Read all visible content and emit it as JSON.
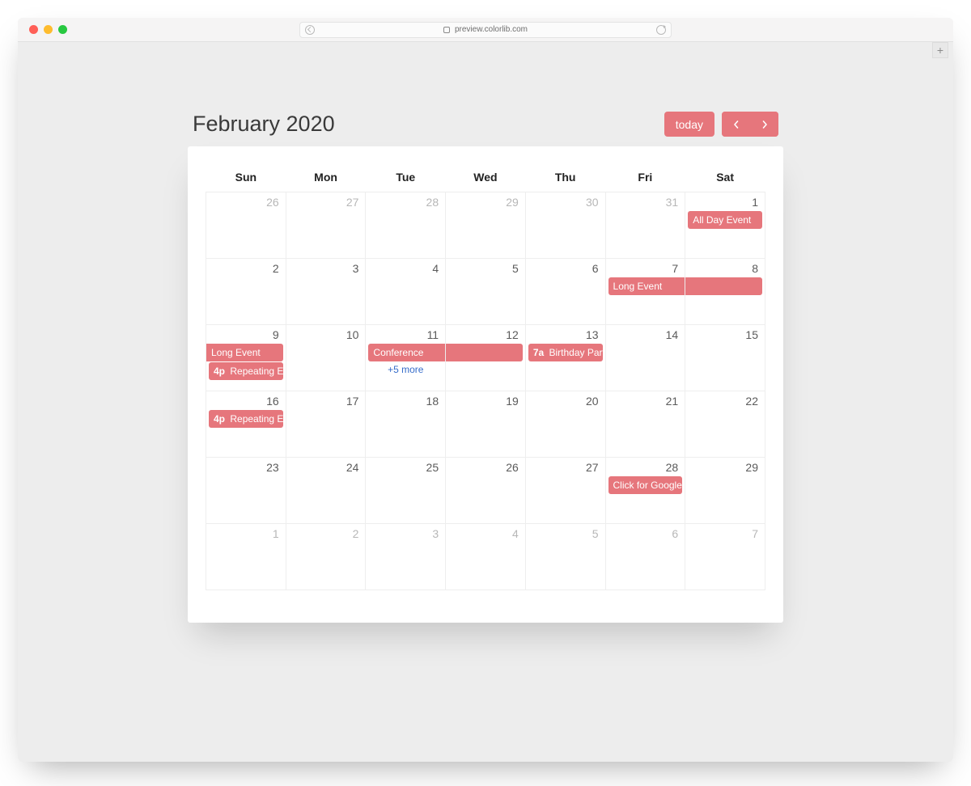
{
  "browser": {
    "url_host": "preview.colorlib.com"
  },
  "header": {
    "title": "February 2020",
    "today_label": "today"
  },
  "calendar": {
    "day_headers": [
      "Sun",
      "Mon",
      "Tue",
      "Wed",
      "Thu",
      "Fri",
      "Sat"
    ],
    "weeks": [
      [
        {
          "n": "26",
          "out": true
        },
        {
          "n": "27",
          "out": true
        },
        {
          "n": "28",
          "out": true
        },
        {
          "n": "29",
          "out": true
        },
        {
          "n": "30",
          "out": true
        },
        {
          "n": "31",
          "out": true
        },
        {
          "n": "1"
        }
      ],
      [
        {
          "n": "2"
        },
        {
          "n": "3"
        },
        {
          "n": "4"
        },
        {
          "n": "5"
        },
        {
          "n": "6"
        },
        {
          "n": "7"
        },
        {
          "n": "8"
        }
      ],
      [
        {
          "n": "9"
        },
        {
          "n": "10"
        },
        {
          "n": "11"
        },
        {
          "n": "12"
        },
        {
          "n": "13"
        },
        {
          "n": "14"
        },
        {
          "n": "15"
        }
      ],
      [
        {
          "n": "16"
        },
        {
          "n": "17"
        },
        {
          "n": "18"
        },
        {
          "n": "19"
        },
        {
          "n": "20"
        },
        {
          "n": "21"
        },
        {
          "n": "22"
        }
      ],
      [
        {
          "n": "23"
        },
        {
          "n": "24"
        },
        {
          "n": "25"
        },
        {
          "n": "26"
        },
        {
          "n": "27"
        },
        {
          "n": "28"
        },
        {
          "n": "29"
        }
      ],
      [
        {
          "n": "1",
          "out": true
        },
        {
          "n": "2",
          "out": true
        },
        {
          "n": "3",
          "out": true
        },
        {
          "n": "4",
          "out": true
        },
        {
          "n": "5",
          "out": true
        },
        {
          "n": "6",
          "out": true
        },
        {
          "n": "7",
          "out": true
        }
      ]
    ],
    "events": {
      "all_day_event": "All Day Event",
      "long_event": "Long Event",
      "conference": "Conference",
      "birthday_time": "7a",
      "birthday": "Birthday Party",
      "repeat_time": "4p",
      "repeat": "Repeating Eve",
      "more": "+5 more",
      "google": "Click for Google"
    }
  },
  "colors": {
    "accent": "#e6767c"
  }
}
